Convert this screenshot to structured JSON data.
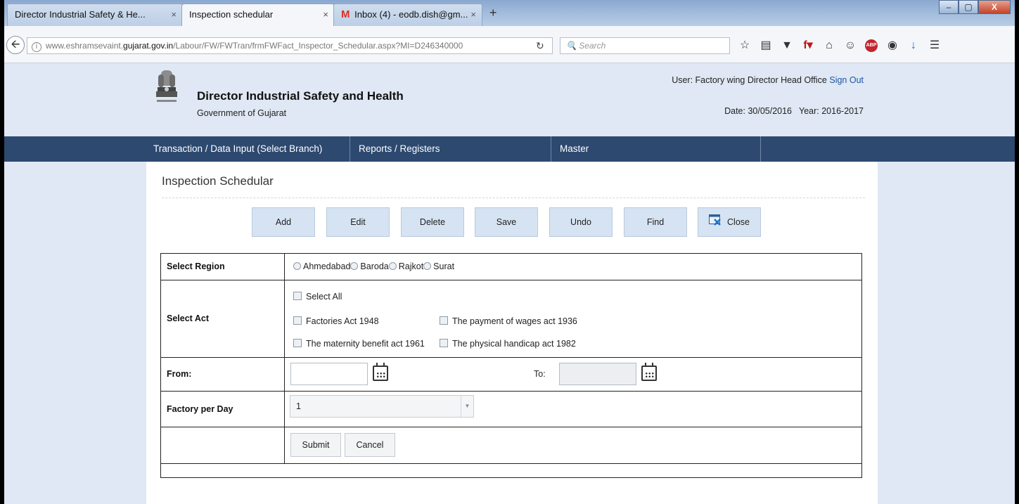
{
  "browser": {
    "tabs": [
      {
        "label": "Director Industrial Safety & He...",
        "active": false
      },
      {
        "label": "Inspection schedular",
        "active": true
      },
      {
        "label": "Inbox (4) - eodb.dish@gm...",
        "active": false
      }
    ],
    "tab_close": "×",
    "new_tab": "+",
    "url_prefix": "www.eshramsevaint.",
    "url_host": "gujarat.gov.in",
    "url_path": "/Labour/FW/FWTran/frmFWFact_Inspector_Schedular.aspx?MI=D246340000",
    "search_placeholder": "Search",
    "window_buttons": [
      "–",
      "▢",
      "X"
    ]
  },
  "site": {
    "org_title": "Director Industrial Safety and Health",
    "org_subtitle": "Government of Gujarat",
    "user_prefix": "User: Factory wing Director Head Office",
    "sign_out": "Sign Out",
    "date_text": "Date: 30/05/2016",
    "year_text": "Year: 2016-2017"
  },
  "menu": [
    "Transaction / Data Input (Select Branch)",
    "Reports / Registers",
    "Master"
  ],
  "page": {
    "heading": "Inspection Schedular",
    "toolbar": [
      "Add",
      "Edit",
      "Delete",
      "Save",
      "Undo",
      "Find",
      "Close"
    ]
  },
  "form": {
    "region_label": "Select Region",
    "regions": [
      "Ahmedabad",
      "Baroda",
      "Rajkot",
      "Surat"
    ],
    "act_label": "Select Act",
    "select_all": "Select All",
    "acts": [
      "Factories Act 1948",
      "The payment of wages act 1936",
      "The maternity benefit act 1961",
      "The physical handicap act 1982"
    ],
    "from_label": "From:",
    "from_value": "",
    "to_label": "To:",
    "to_value": "",
    "factory_label": "Factory per Day",
    "factory_value": "1",
    "submit": "Submit",
    "cancel": "Cancel"
  }
}
